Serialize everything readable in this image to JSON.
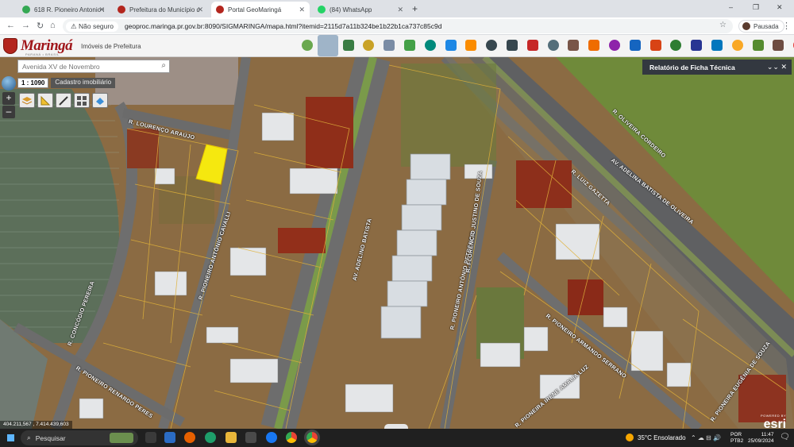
{
  "browser": {
    "tabs": [
      {
        "title": "618 R. Pioneiro Antonio de Ga…",
        "icon": "maps-pin-icon",
        "active": false
      },
      {
        "title": "Prefeitura do Município de Ma…",
        "icon": "city-crest-icon",
        "active": false
      },
      {
        "title": "Portal GeoMaringá",
        "icon": "city-crest-icon",
        "active": true
      },
      {
        "title": "(84) WhatsApp",
        "icon": "whatsapp-icon",
        "active": false
      }
    ],
    "new_tab": "+",
    "security_label": "Não seguro",
    "url": "geoproc.maringa.pr.gov.br:8090/SIGMARINGA/mapa.html?itemid=2115d7a11b324be1b22b1ca737c85c9d",
    "profile_label": "Pausada",
    "window_controls": [
      "–",
      "❐",
      "✕"
    ]
  },
  "app": {
    "logo_text": "Maringá",
    "logo_sub": "PARANÁ • BRASIL",
    "subtitle": "Imóveis de Prefeitura",
    "tools": [
      "tool-1",
      "tool-2",
      "tool-3",
      "tool-4",
      "tool-5",
      "tool-6",
      "tool-7",
      "tool-8",
      "tool-9",
      "tool-10",
      "tool-11",
      "tool-12",
      "tool-13",
      "tool-14",
      "tool-15",
      "tool-16",
      "tool-17",
      "tool-18",
      "tool-19",
      "tool-20",
      "tool-21",
      "tool-22",
      "tool-23",
      "tool-24",
      "tool-25",
      "tool-26",
      "tool-27",
      "tool-28",
      "tool-29",
      "tool-30",
      "tool-31"
    ],
    "tool_colors": [
      "#6aa84f",
      "#9fb4c8",
      "#3a7d44",
      "#c9a227",
      "#7a8ca5",
      "#43a047",
      "#00897b",
      "#1e88e5",
      "#fb8c00",
      "#37474f",
      "#37474f",
      "#c62828",
      "#546e7a",
      "#795548",
      "#ef6c00",
      "#8e24aa",
      "#1565c0",
      "#d84315",
      "#2e7d32",
      "#283593",
      "#0277bd",
      "#f9a825",
      "#558b2f",
      "#6d4c41",
      "#e53935"
    ]
  },
  "map": {
    "search_placeholder": "Avenida XV de Novembro",
    "scale_label": "1 : 1090",
    "layer_label": "Cadastro imobiliário",
    "zoom_in": "+",
    "zoom_out": "–",
    "report_panel_title": "Relatório de Ficha Técnica",
    "report_controls": "⌄⌄  ✕",
    "coordinates": "404.211,567 , 7.414.439,603",
    "attribution_powered": "POWERED BY",
    "attribution": "esri",
    "streets": [
      {
        "label": "R. LOURENÇO ARAÚJO"
      },
      {
        "label": "R. PIONEIRO ANTÔNIO CAVALLI"
      },
      {
        "label": "R. CONCÓDIO PEREIRA"
      },
      {
        "label": "R. PIONEIRO RENARDO PERES"
      },
      {
        "label": "AV. ADELINO BATISTA"
      },
      {
        "label": "R. PIONEIRO ANTÔNIO PETRENCO"
      },
      {
        "label": "R. FLORÊNCIO JUSTINO DE SOUZA"
      },
      {
        "label": "R. OLIVEIRA CORDEIRO"
      },
      {
        "label": "R. LUIZ GAZETTA"
      },
      {
        "label": "AV. ADELINA BATISTA DE OLIVEIRA"
      },
      {
        "label": "R. PIONEIRO ARMANDO SERRANO"
      },
      {
        "label": "R. PIONEIRA EUGÊNIA DE SOUZA"
      },
      {
        "label": "R. PIONEIRA IRENE AMALIA LUZ"
      }
    ]
  },
  "taskbar": {
    "search_label": "Pesquisar",
    "weather": "35°C  Ensolarado",
    "tray": "⌃  ☁  ⊟  🔊",
    "lang_line1": "POR",
    "lang_line2": "PTB2",
    "time": "11:47",
    "date": "25/09/2024"
  }
}
